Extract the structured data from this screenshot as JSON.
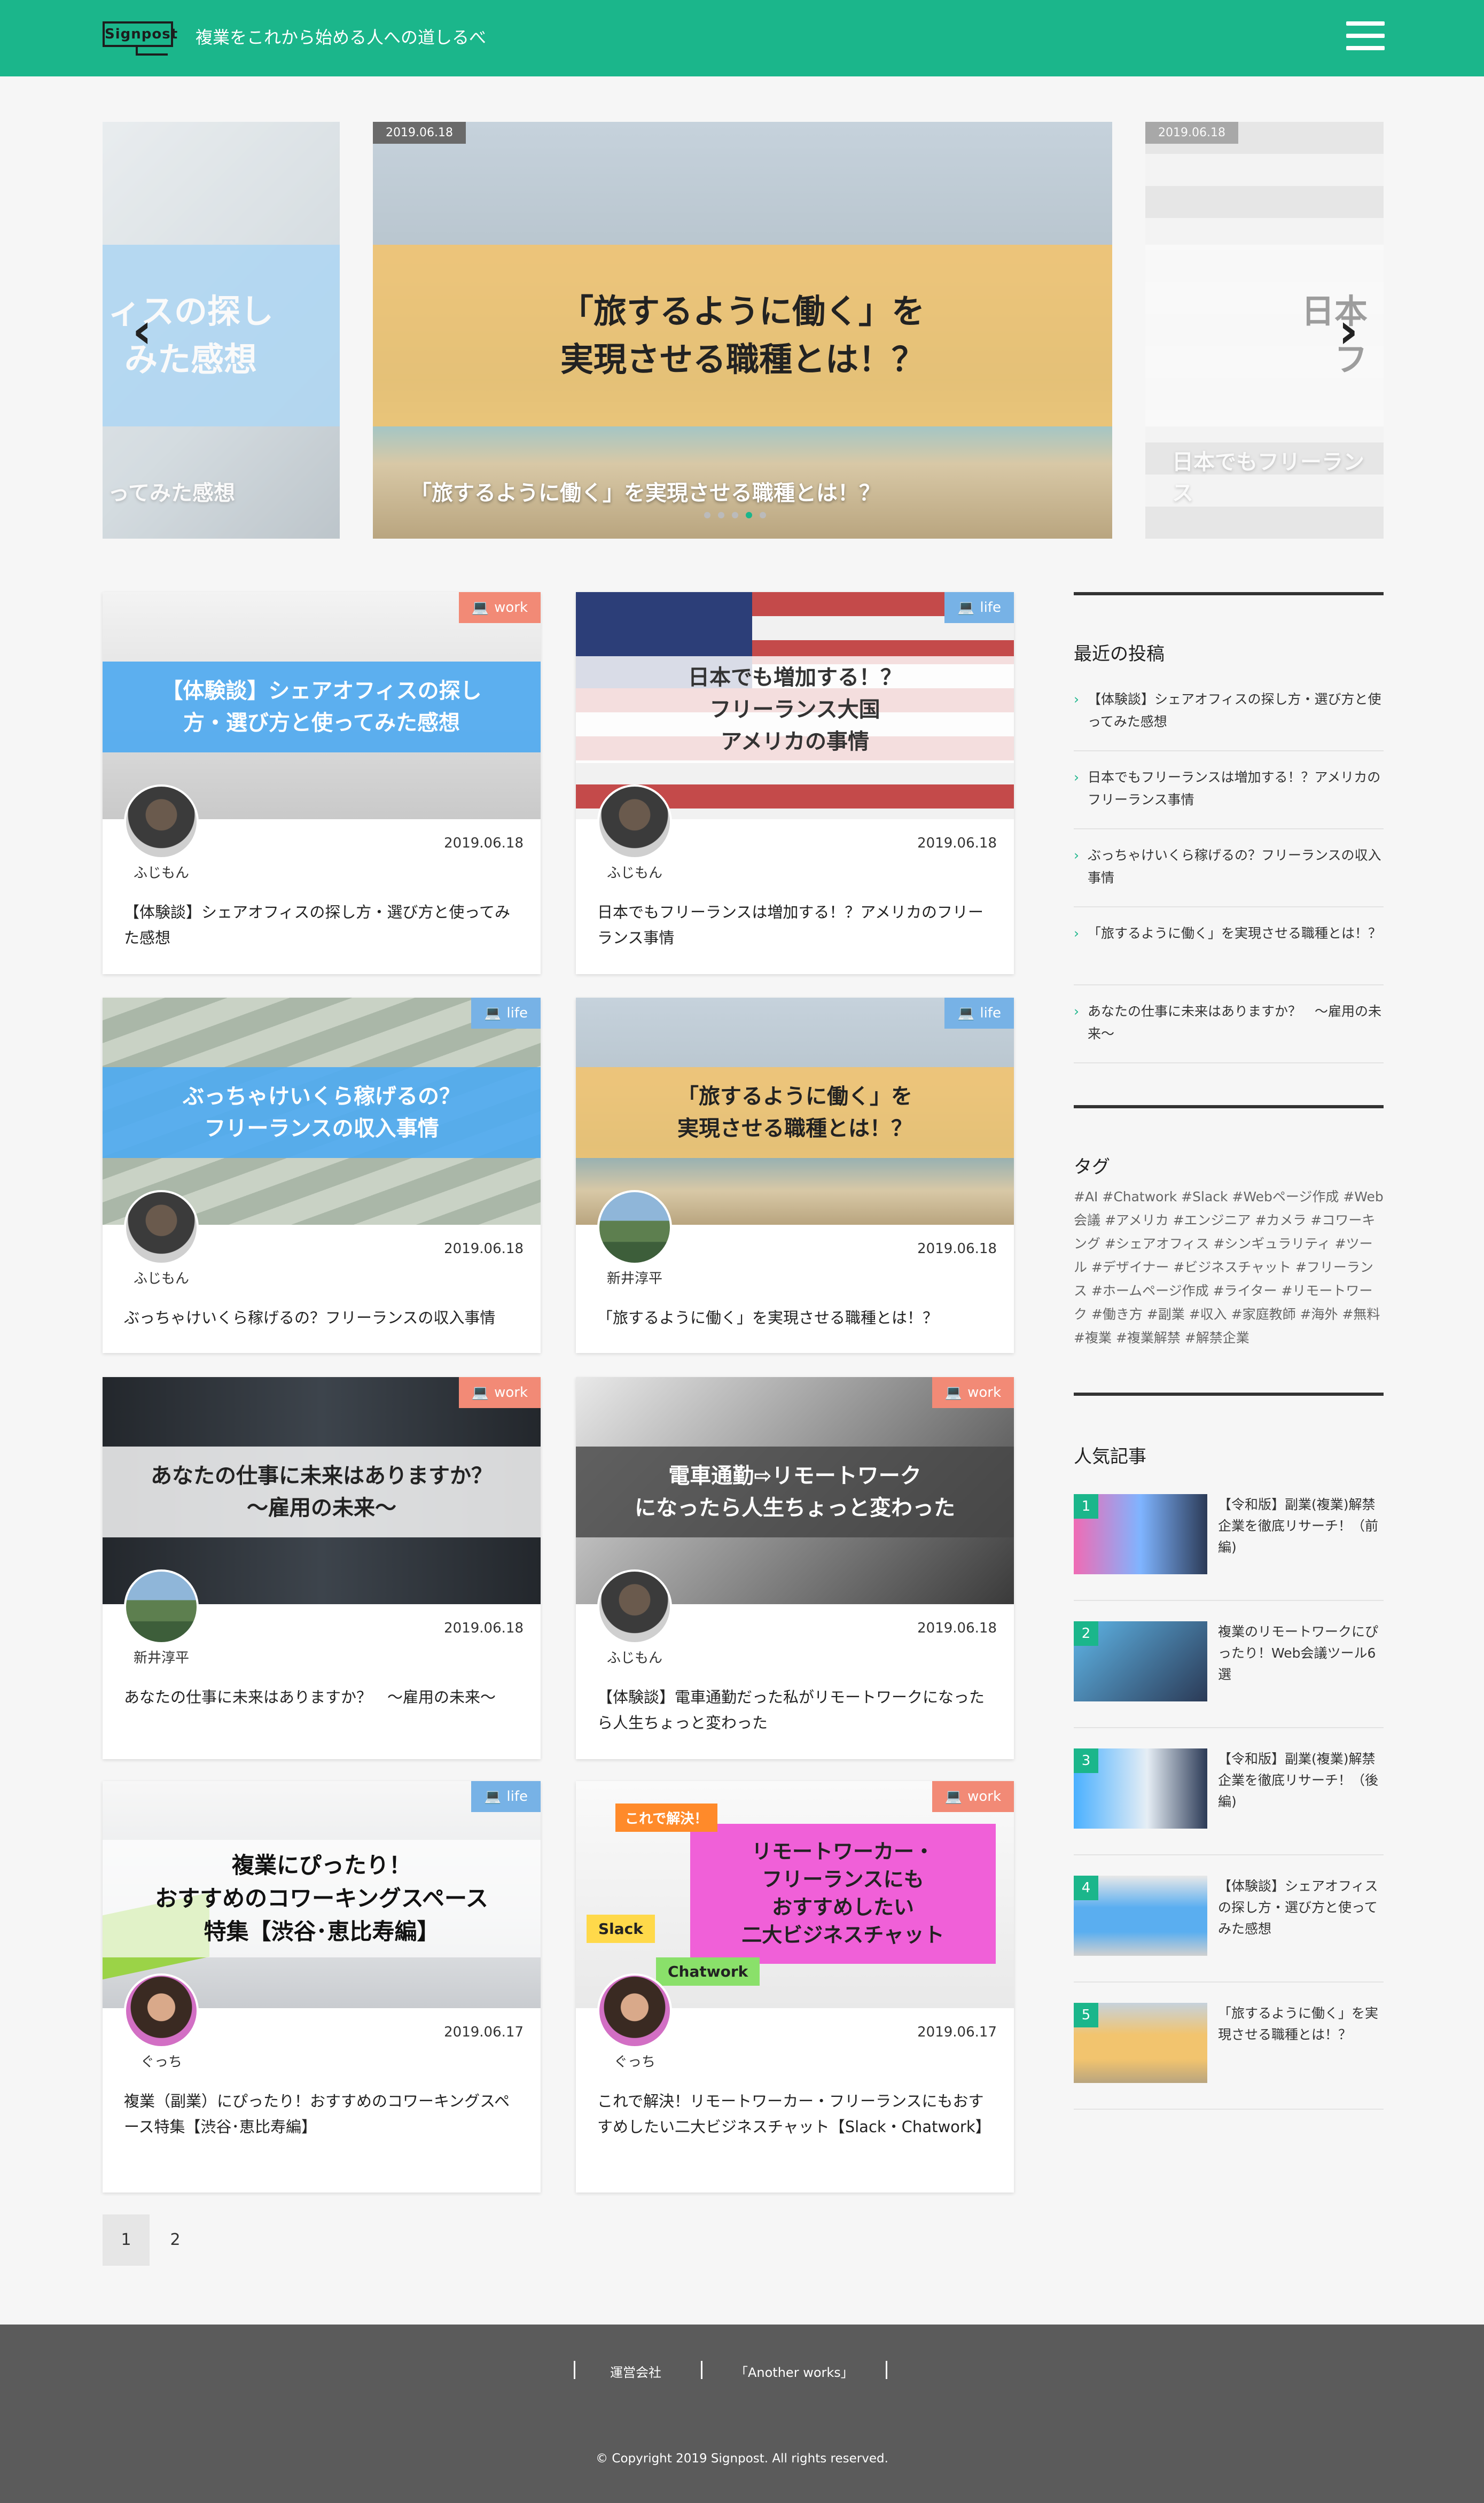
{
  "header": {
    "logo_text": "Signpost",
    "tagline": "複業をこれから始める人への道しるべ",
    "brand_color": "#1bb68b"
  },
  "slider": {
    "prev": {
      "band_text": "ィスの探し\nみた感想",
      "caption": "ってみた感想"
    },
    "current": {
      "date": "2019.06.18",
      "band_text": "「旅するように働く」を\n実現させる職種とは！？",
      "caption": "「旅するように働く」を実現させる職種とは！？"
    },
    "next": {
      "date": "2019.06.18",
      "band_text": "日本\nフ",
      "caption": "日本でもフリーランス"
    }
  },
  "cards": [
    {
      "category": "work",
      "thumb_text": "【体験談】シェアオフィスの探し\n方・選び方と使ってみた感想",
      "author": "ふじもん",
      "date": "2019.06.18",
      "title": "【体験談】シェアオフィスの探し方・選び方と使ってみた感想"
    },
    {
      "category": "life",
      "thumb_text": "日本でも増加する！？\nフリーランス大国\nアメリカの事情",
      "author": "ふじもん",
      "date": "2019.06.18",
      "title": "日本でもフリーランスは増加する！？アメリカのフリーランス事情"
    },
    {
      "category": "life",
      "thumb_text": "ぶっちゃけいくら稼げるの？\nフリーランスの収入事情",
      "author": "ふじもん",
      "date": "2019.06.18",
      "title": "ぶっちゃけいくら稼げるの？フリーランスの収入事情"
    },
    {
      "category": "life",
      "thumb_text": "「旅するように働く」を\n実現させる職種とは！？",
      "author": "新井淳平",
      "date": "2019.06.18",
      "title": "「旅するように働く」を実現させる職種とは！？"
    },
    {
      "category": "work",
      "thumb_text": "あなたの仕事に未来はありますか？\n〜雇用の未来〜",
      "author": "新井淳平",
      "date": "2019.06.18",
      "title": "あなたの仕事に未来はありますか？　〜雇用の未来〜"
    },
    {
      "category": "work",
      "thumb_text": "電車通勤⇨リモートワーク\nになったら人生ちょっと変わった",
      "author": "ふじもん",
      "date": "2019.06.18",
      "title": "【体験談】電車通勤だった私がリモートワークになったら人生ちょっと変わった"
    },
    {
      "category": "life",
      "thumb_text": "複業にぴったり！\nおすすめのコワーキングスペース\n特集【渋谷･恵比寿編】",
      "author": "ぐっち",
      "date": "2019.06.17",
      "title": "複業（副業）にぴったり！おすすめのコワーキングスペース特集【渋谷･恵比寿編】"
    },
    {
      "category": "work",
      "thumb_text": "リモートワーカー・\nフリーランスにも\nおすすめしたい\n二大ビジネスチャット",
      "thumb_extra": [
        "これで解決！",
        "Slack",
        "Chatwork"
      ],
      "author": "ぐっち",
      "date": "2019.06.17",
      "title": "これで解決！リモートワーカー・フリーランスにもおすすめしたい二大ビジネスチャット【Slack・Chatwork】"
    }
  ],
  "sidebar": {
    "recent_heading": "最近の投稿",
    "recent": [
      "【体験談】シェアオフィスの探し方・選び方と使ってみた感想",
      "日本でもフリーランスは増加する！？アメリカのフリーランス事情",
      "ぶっちゃけいくら稼げるの？フリーランスの収入事情",
      "「旅するように働く」を実現させる職種とは！？",
      "あなたの仕事に未来はありますか？　〜雇用の未来〜"
    ],
    "tags_heading": "タグ",
    "tags": "#AI #Chatwork #Slack #Webページ作成 #Web会議 #アメリカ #エンジニア #カメラ #コワーキング #シェアオフィス #シンギュラリティ #ツール #デザイナー #ビジネスチャット #フリーランス #ホームページ作成 #ライター #リモートワーク #働き方 #副業 #収入 #家庭教師 #海外 #無料 #複業 #複業解禁 #解禁企業",
    "popular_heading": "人気記事",
    "popular": [
      {
        "num": "1",
        "title": "【令和版】副業(複業)解禁企業を徹底リサーチ！（前編)"
      },
      {
        "num": "2",
        "title": "複業のリモートワークにぴったり！Web会議ツール6選"
      },
      {
        "num": "3",
        "title": "【令和版】副業(複業)解禁企業を徹底リサーチ！（後編)"
      },
      {
        "num": "4",
        "title": "【体験談】シェアオフィスの探し方・選び方と使ってみた感想"
      },
      {
        "num": "5",
        "title": "「旅するように働く」を実現させる職種とは！？"
      }
    ]
  },
  "pagination": {
    "current": "1",
    "next": "2"
  },
  "footer": {
    "links": [
      "運営会社",
      "「Another works」"
    ],
    "copyright": "© Copyright 2019 Signpost. All rights reserved."
  }
}
